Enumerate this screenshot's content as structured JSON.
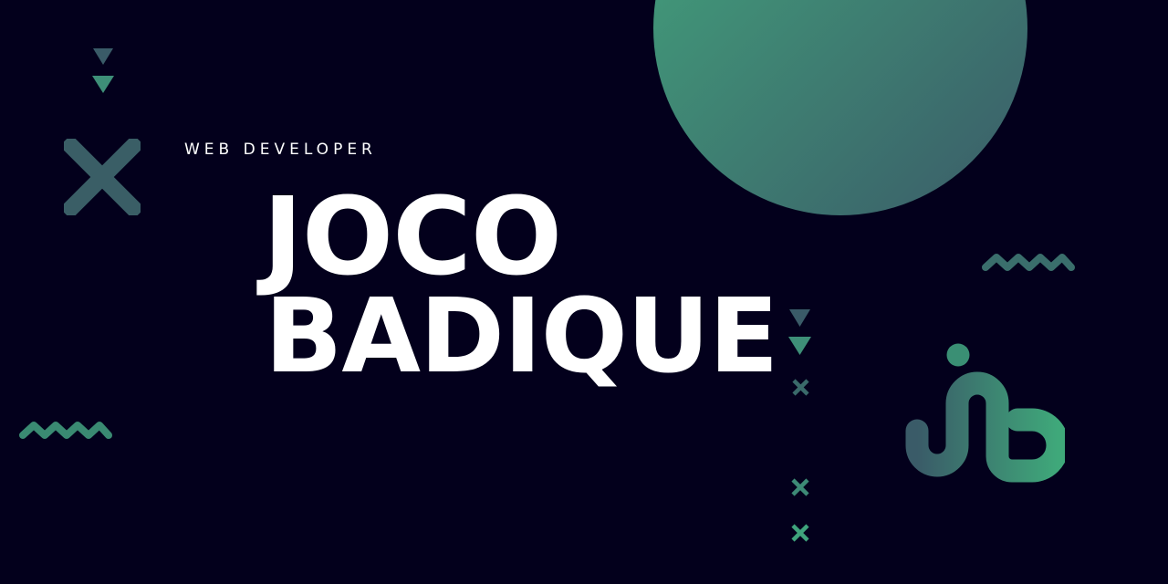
{
  "header": {
    "subtitle": "WEB DEVELOPER"
  },
  "name": {
    "first": "JOCO",
    "last": "BADIQUE"
  },
  "colors": {
    "background": "#03001c",
    "accent_green": "#3fa37c",
    "accent_teal": "#3a5e6a",
    "text": "#ffffff"
  },
  "icons": [
    "jb-logo-icon",
    "triangle-down-icon",
    "x-cross-icon",
    "zigzag-wave-icon",
    "circle-decoration"
  ]
}
